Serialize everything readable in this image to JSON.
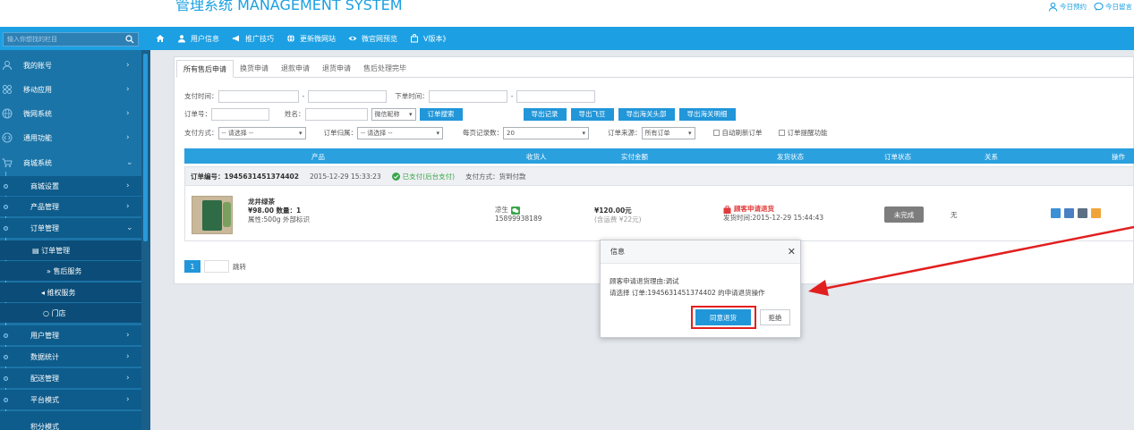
{
  "header": {
    "title": "管理系统 MANAGEMENT SYSTEM",
    "right_links": [
      {
        "label": "今日预约",
        "icon": "user-icon"
      },
      {
        "label": "今日留言",
        "icon": "comment-icon"
      }
    ]
  },
  "search": {
    "placeholder": "输入你想找的栏目"
  },
  "nav": {
    "home_icon": "home-icon",
    "items": [
      {
        "label": "用户信息",
        "icon": "user-icon"
      },
      {
        "label": "推广技巧",
        "icon": "megaphone-icon"
      },
      {
        "label": "更新微网站",
        "icon": "globe-icon"
      },
      {
        "label": "微官网预览",
        "icon": "eye-icon"
      },
      {
        "label": "V版本》",
        "icon": "bag-icon"
      }
    ]
  },
  "sidebar": {
    "items": [
      {
        "label": "我的账号",
        "icon": "account-icon"
      },
      {
        "label": "移动应用",
        "icon": "apps-icon"
      },
      {
        "label": "微网系统",
        "icon": "globe-icon"
      },
      {
        "label": "通用功能",
        "icon": "function-icon"
      },
      {
        "label": "商城系统",
        "icon": "cart-icon"
      }
    ],
    "sub_items": [
      {
        "label": "商城设置"
      },
      {
        "label": "产品管理"
      },
      {
        "label": "订单管理"
      }
    ],
    "order_items": [
      {
        "label": "订单管理",
        "icon": "list-icon"
      },
      {
        "label": "售后服务",
        "icon": "double-chevron-icon"
      },
      {
        "label": "维权服务",
        "icon": "megaphone-icon"
      },
      {
        "label": "门店",
        "icon": "chat-icon"
      }
    ],
    "more_items": [
      {
        "label": "用户管理"
      },
      {
        "label": "数据统计"
      },
      {
        "label": "配送管理"
      },
      {
        "label": "平台模式"
      },
      {
        "label": "积分模式"
      }
    ]
  },
  "tabs": [
    "所有售后申请",
    "换货申请",
    "退款申请",
    "退货申请",
    "售后处理完毕"
  ],
  "filters": {
    "pay_time_label": "支付时间：",
    "order_time_label": "下单时间：",
    "dash": "-",
    "order_no_label": "订单号：",
    "name_label": "姓名：",
    "nickname_select": "微信昵称",
    "search_button": "订单搜索",
    "export_buttons": [
      "导出记录",
      "导出飞豆",
      "导出海关头部",
      "导出海关明细"
    ],
    "pay_method_label": "支付方式：",
    "pay_method_value": "-- 请选择 --",
    "order_group_label": "订单归属：",
    "order_group_value": "-- 请选择 --",
    "per_page_label": "每页记录数：",
    "per_page_value": "20",
    "source_label": "订单来源：",
    "source_value": "所有订单",
    "auto_refresh": "自动刷新订单",
    "reminder": "订单提醒功能"
  },
  "table": {
    "headers": [
      "产品",
      "收货人",
      "实付金额",
      "发货状态",
      "订单状态",
      "关系",
      "操作"
    ],
    "order": {
      "order_no": "订单编号：1945631451374402",
      "time": "2015-12-29 15:33:23",
      "paid": "已支付(后台支付)",
      "pay_method": "支付方式：货到付款",
      "product_name": "龙井绿茶",
      "price_qty": "¥98.00 数量：1",
      "attrs": "属性:500g 外部标识",
      "receiver": "凉生",
      "phone": "15899938189",
      "amount": "¥120.00元",
      "freight": "(含运费 ¥22元)",
      "ship_status": "顾客申请退货",
      "ship_time": "发货时间:2015-12-29 15:44:43",
      "order_status": "未完成",
      "relation": "无"
    }
  },
  "pager": {
    "page": "1",
    "jump": "跳转"
  },
  "dialog": {
    "title": "信息",
    "line1": "顾客申请退货理由:调试",
    "line2": "请选择 订单:1945631451374402 的申请退货操作",
    "agree": "同意退货",
    "reject": "拒绝"
  },
  "colors": {
    "accent": "#1ca0e3",
    "sidebar": "#1b74a7",
    "highlight": "#e21f1f"
  }
}
